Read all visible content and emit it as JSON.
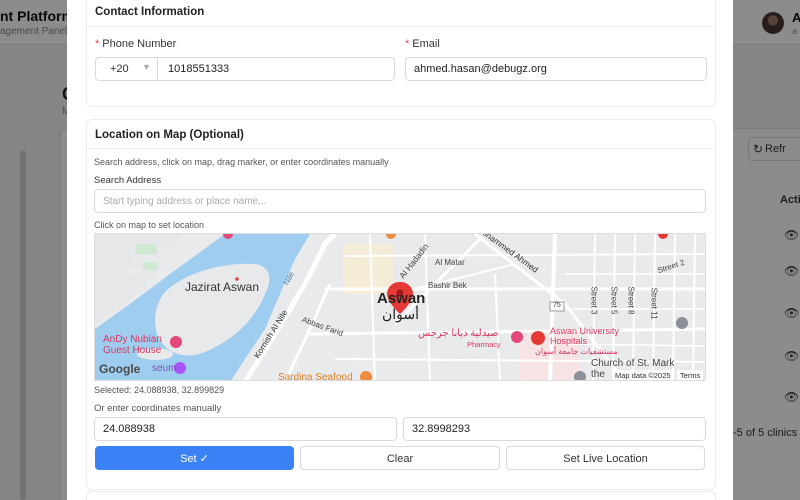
{
  "background": {
    "brand": "nt Platform",
    "brand_sub": "agement Panel",
    "user_initial": "A",
    "user_sub": "a",
    "page_title": "C",
    "page_sub": "M",
    "refresh_label": "Refr",
    "actions_header": "Acti",
    "pagination": "-5 of 5 clinics"
  },
  "contact": {
    "title": "Contact Information",
    "phone_label": "Phone Number",
    "country_code": "+20",
    "phone_value": "1018551333",
    "email_label": "Email",
    "email_value": "ahmed.hasan@debugz.org"
  },
  "location": {
    "title": "Location on Map (Optional)",
    "instructions": "Search address, click on map, drag marker, or enter coordinates manually",
    "search_label": "Search Address",
    "search_placeholder": "Start typing address or place name...",
    "map_hint": "Click on map to set location",
    "selected_text": "Selected: 24.088938, 32.899829",
    "manual_label": "Or enter coordinates manually",
    "lat_value": "24.088938",
    "lng_value": "32.8998293",
    "set_label": "Set ✓",
    "clear_label": "Clear",
    "live_label": "Set Live Location"
  },
  "map": {
    "labels": {
      "jazirat": "Jazirat Aswan",
      "nile": "Nile",
      "corniche": "Kornish Al Nile",
      "abbas": "Abbas Farid",
      "aswan_en": "Aswan",
      "aswan_ar": "أسوان",
      "hadadin": "Al Hadadin",
      "matar": "Al Matar",
      "bashir": "Bashir Bek",
      "mohammed": "ohammed Ahmed",
      "street2": "Street 2",
      "street3": "Street 3",
      "street5": "Street 5",
      "street8": "Street 8",
      "street11": "Street 11",
      "pharmacy_ar": "صيدلية ديانا جرجس",
      "pharmacy_en": "Pharmacy",
      "hospital_en1": "Aswan University",
      "hospital_en2": "Hospitals",
      "hospital_ar": "مستشفيات جامعة أسوان",
      "church": "Church of St. Mark",
      "church2": "the",
      "andy1": "AnDy Nubian",
      "andy2": "Guest House",
      "sardina": "Sardina Seafood",
      "seum": "seum",
      "road75": "75",
      "google": "Google",
      "attribution": "Map data ©2025",
      "terms": "Terms"
    },
    "colors": {
      "water": "#9fcdf0",
      "land": "#e9eaec",
      "road": "#ffffff",
      "marker": "#e53935",
      "poi_pink": "#e4477a"
    }
  }
}
